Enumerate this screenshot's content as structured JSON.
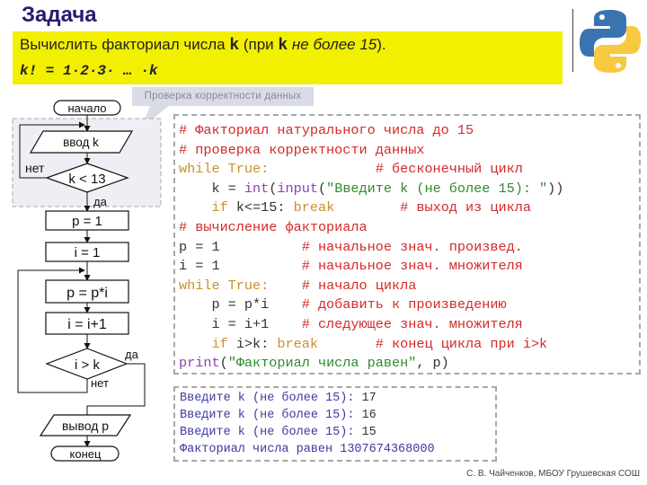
{
  "title": "Задача",
  "task": {
    "line1_prefix": "Вычислить факториал числа ",
    "line1_var": "k",
    "line1_mid": "  (при ",
    "line1_var2": "k",
    "line1_italic": " не более 15",
    "line1_suffix": ").",
    "line2": "k! = 1·2·3· … ·k"
  },
  "callout": "Проверка корректности данных",
  "logo": {
    "name": "python-logo",
    "colors": {
      "blue": "#3a74b0",
      "yellow": "#f7c940"
    }
  },
  "flowchart": {
    "start": "начало",
    "input": "ввод k",
    "cond1": "k < 13",
    "cond1_no": "нет",
    "cond1_yes": "да",
    "p_init": "p = 1",
    "i_init": "i = 1",
    "mult": "p = p*i",
    "incr": "i = i+1",
    "cond2": "i > k",
    "cond2_yes": "да",
    "cond2_no": "нет",
    "output": "вывод p",
    "end": "конец"
  },
  "code": {
    "lines": [
      [
        {
          "t": "# Факториал натурального числа до 15",
          "c": "cm"
        }
      ],
      [
        {
          "t": "# проверка корректности данных",
          "c": "cm"
        }
      ],
      [
        {
          "t": "while True:",
          "c": "kw"
        },
        {
          "t": "             ",
          "c": "tx"
        },
        {
          "t": "# бесконечный цикл",
          "c": "cm"
        }
      ],
      [
        {
          "t": "    k = ",
          "c": "tx"
        },
        {
          "t": "int",
          "c": "bi"
        },
        {
          "t": "(",
          "c": "tx"
        },
        {
          "t": "input",
          "c": "bi"
        },
        {
          "t": "(",
          "c": "tx"
        },
        {
          "t": "\"Введите k (не более 15): \"",
          "c": "st"
        },
        {
          "t": "))",
          "c": "tx"
        }
      ],
      [
        {
          "t": "    ",
          "c": "tx"
        },
        {
          "t": "if",
          "c": "kw"
        },
        {
          "t": " k<=15: ",
          "c": "tx"
        },
        {
          "t": "break",
          "c": "kw"
        },
        {
          "t": "        ",
          "c": "tx"
        },
        {
          "t": "# выход из цикла",
          "c": "cm"
        }
      ],
      [
        {
          "t": "# вычисление факториала",
          "c": "cm"
        }
      ],
      [
        {
          "t": "p = 1          ",
          "c": "tx"
        },
        {
          "t": "# начальное знач. произвед.",
          "c": "cm"
        }
      ],
      [
        {
          "t": "i = 1          ",
          "c": "tx"
        },
        {
          "t": "# начальное знач. множителя",
          "c": "cm"
        }
      ],
      [
        {
          "t": "while True:",
          "c": "kw"
        },
        {
          "t": "    ",
          "c": "tx"
        },
        {
          "t": "# начало цикла",
          "c": "cm"
        }
      ],
      [
        {
          "t": "    p = p*i    ",
          "c": "tx"
        },
        {
          "t": "# добавить к произведению",
          "c": "cm"
        }
      ],
      [
        {
          "t": "    i = i+1    ",
          "c": "tx"
        },
        {
          "t": "# следующее знач. множителя",
          "c": "cm"
        }
      ],
      [
        {
          "t": "    ",
          "c": "tx"
        },
        {
          "t": "if",
          "c": "kw"
        },
        {
          "t": " i>k: ",
          "c": "tx"
        },
        {
          "t": "break",
          "c": "kw"
        },
        {
          "t": "       ",
          "c": "tx"
        },
        {
          "t": "# конец цикла при i>k",
          "c": "cm"
        }
      ],
      [
        {
          "t": "print",
          "c": "bi"
        },
        {
          "t": "(",
          "c": "tx"
        },
        {
          "t": "\"Факториал числа равен\"",
          "c": "st"
        },
        {
          "t": ", p)",
          "c": "tx"
        }
      ]
    ]
  },
  "output": {
    "lines": [
      {
        "prompt": "Введите k (не более 15): ",
        "value": "17"
      },
      {
        "prompt": "Введите k (не более 15): ",
        "value": "16"
      },
      {
        "prompt": "Введите k (не более 15): ",
        "value": "15"
      },
      {
        "prompt": "Факториал числа равен 1307674368000",
        "value": ""
      }
    ]
  },
  "credit": "С. В. Чайченков, МБОУ Грушевская СОШ"
}
